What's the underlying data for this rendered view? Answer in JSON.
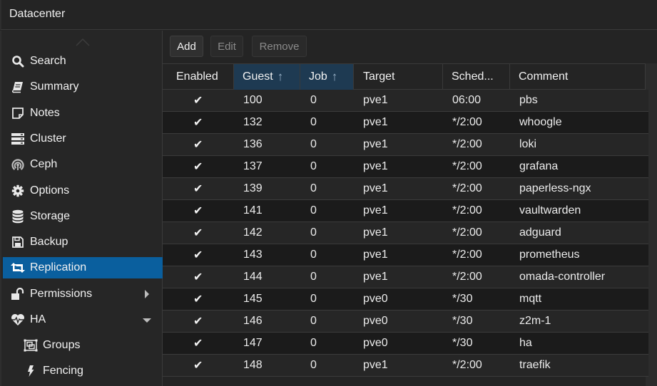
{
  "header": {
    "title": "Datacenter"
  },
  "sidebar": {
    "items": [
      {
        "label": "Search",
        "icon": "search-icon",
        "active": false
      },
      {
        "label": "Summary",
        "icon": "book-icon",
        "active": false
      },
      {
        "label": "Notes",
        "icon": "sticky-note-icon",
        "active": false
      },
      {
        "label": "Cluster",
        "icon": "server-icon",
        "active": false
      },
      {
        "label": "Ceph",
        "icon": "ceph-icon",
        "active": false
      },
      {
        "label": "Options",
        "icon": "gear-icon",
        "active": false
      },
      {
        "label": "Storage",
        "icon": "database-icon",
        "active": false
      },
      {
        "label": "Backup",
        "icon": "floppy-icon",
        "active": false
      },
      {
        "label": "Replication",
        "icon": "retweet-icon",
        "active": true
      },
      {
        "label": "Permissions",
        "icon": "unlock-icon",
        "active": false,
        "expander": "collapsed"
      },
      {
        "label": "HA",
        "icon": "heartbeat-icon",
        "active": false,
        "expander": "expanded"
      },
      {
        "label": "Groups",
        "icon": "object-group-icon",
        "active": false,
        "sub": true
      },
      {
        "label": "Fencing",
        "icon": "bolt-icon",
        "active": false,
        "sub": true
      }
    ]
  },
  "toolbar": {
    "add_label": "Add",
    "edit_label": "Edit",
    "remove_label": "Remove"
  },
  "grid": {
    "columns": [
      {
        "label": "Enabled",
        "sorted": false
      },
      {
        "label": "Guest",
        "sorted": true,
        "sort_dir": "asc"
      },
      {
        "label": "Job",
        "sorted": true,
        "sort_dir": "asc"
      },
      {
        "label": "Target",
        "sorted": false
      },
      {
        "label": "Sched...",
        "sorted": false
      },
      {
        "label": "Comment",
        "sorted": false
      }
    ],
    "sort_glyph": "↑",
    "check_glyph": "✔",
    "rows": [
      {
        "enabled": true,
        "guest": "100",
        "job": "0",
        "target": "pve1",
        "schedule": "06:00",
        "comment": "pbs"
      },
      {
        "enabled": true,
        "guest": "132",
        "job": "0",
        "target": "pve1",
        "schedule": "*/2:00",
        "comment": "whoogle"
      },
      {
        "enabled": true,
        "guest": "136",
        "job": "0",
        "target": "pve1",
        "schedule": "*/2:00",
        "comment": "loki"
      },
      {
        "enabled": true,
        "guest": "137",
        "job": "0",
        "target": "pve1",
        "schedule": "*/2:00",
        "comment": "grafana"
      },
      {
        "enabled": true,
        "guest": "139",
        "job": "0",
        "target": "pve1",
        "schedule": "*/2:00",
        "comment": "paperless-ngx"
      },
      {
        "enabled": true,
        "guest": "141",
        "job": "0",
        "target": "pve1",
        "schedule": "*/2:00",
        "comment": "vaultwarden"
      },
      {
        "enabled": true,
        "guest": "142",
        "job": "0",
        "target": "pve1",
        "schedule": "*/2:00",
        "comment": "adguard"
      },
      {
        "enabled": true,
        "guest": "143",
        "job": "0",
        "target": "pve1",
        "schedule": "*/2:00",
        "comment": "prometheus"
      },
      {
        "enabled": true,
        "guest": "144",
        "job": "0",
        "target": "pve1",
        "schedule": "*/2:00",
        "comment": "omada-controller"
      },
      {
        "enabled": true,
        "guest": "145",
        "job": "0",
        "target": "pve0",
        "schedule": "*/30",
        "comment": "mqtt"
      },
      {
        "enabled": true,
        "guest": "146",
        "job": "0",
        "target": "pve0",
        "schedule": "*/30",
        "comment": "z2m-1"
      },
      {
        "enabled": true,
        "guest": "147",
        "job": "0",
        "target": "pve0",
        "schedule": "*/30",
        "comment": "ha"
      },
      {
        "enabled": true,
        "guest": "148",
        "job": "0",
        "target": "pve1",
        "schedule": "*/2:00",
        "comment": "traefik"
      }
    ]
  },
  "colors": {
    "accent": "#0a5f9e",
    "sorted_header": "#1e3a52"
  }
}
